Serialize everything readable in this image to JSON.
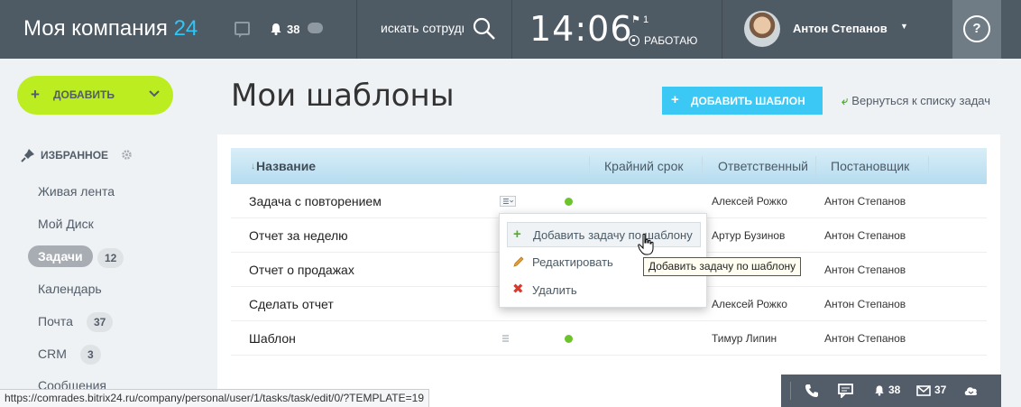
{
  "header": {
    "logo_text": "Моя компания",
    "logo_num": "24",
    "notifications_count": "38",
    "search_placeholder": "искать сотрудника",
    "clock": "14:06",
    "flag_count": "1",
    "work_status": "РАБОТАЮ",
    "user_name": "Антон Степанов",
    "help": "?"
  },
  "sidebar": {
    "add_label": "ДОБАВИТЬ",
    "favorites_label": "ИЗБРАННОЕ",
    "items": [
      {
        "label": "Живая лента"
      },
      {
        "label": "Мой Диск"
      },
      {
        "label": "Задачи",
        "count": "12"
      },
      {
        "label": "Календарь"
      },
      {
        "label": "Почта",
        "count": "37"
      },
      {
        "label": "CRM",
        "count": "3"
      },
      {
        "label": "Сообщения"
      }
    ]
  },
  "main": {
    "title": "Мои шаблоны",
    "add_template_label": "ДОБАВИТЬ ШАБЛОН",
    "back_link": "Вернуться к списку задач"
  },
  "table": {
    "columns": [
      "Название",
      "Крайний срок",
      "Ответственный",
      "Постановщик"
    ],
    "rows": [
      {
        "name": "Задача с повторением",
        "responsible": "Алексей Рожко",
        "creator": "Антон Степанов"
      },
      {
        "name": "Отчет за неделю",
        "responsible": "Артур Бузинов",
        "creator": "Антон Степанов"
      },
      {
        "name": "Отчет о продажах",
        "responsible": "",
        "creator": "Антон Степанов"
      },
      {
        "name": "Сделать отчет",
        "responsible": "Алексей Рожко",
        "creator": "Антон Степанов"
      },
      {
        "name": "Шаблон",
        "responsible": "Тимур Липин",
        "creator": "Антон Степанов"
      }
    ]
  },
  "popup_menu": {
    "items": [
      {
        "label": "Добавить задачу по шаблону",
        "icon": "plus-icon"
      },
      {
        "label": "Редактировать",
        "icon": "pencil-icon"
      },
      {
        "label": "Удалить",
        "icon": "delete-icon"
      }
    ],
    "tooltip": "Добавить задачу по шаблону"
  },
  "status_url": "https://comrades.bitrix24.ru/company/personal/user/1/tasks/task/edit/0/?TEMPLATE=19",
  "bottom_bar": {
    "notifications_count": "38",
    "mail_count": "37"
  },
  "colors": {
    "header_bg": "#4e5a64",
    "accent_blue": "#2fc6f6",
    "add_button": "#bbed21",
    "add_template_button": "#3bc8f5",
    "status_green": "#6dc32b"
  }
}
